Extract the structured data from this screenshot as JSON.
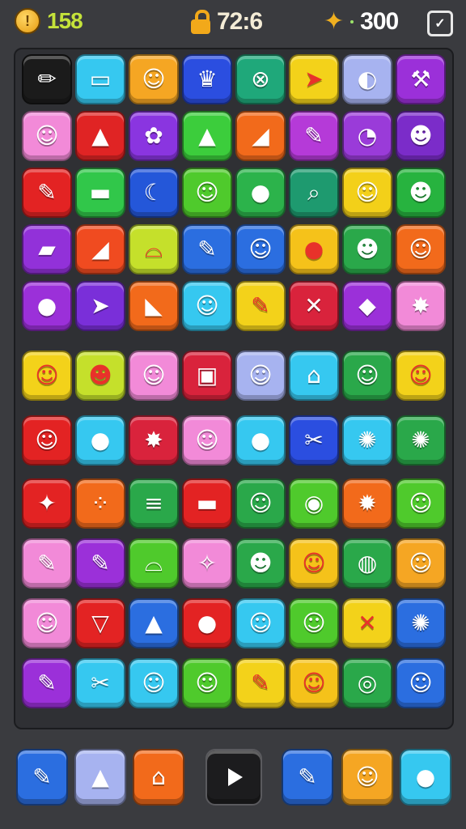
{
  "hud": {
    "coins": "158",
    "coin_icon": "coin-icon",
    "timer": "72:6",
    "lock_icon": "lock-icon",
    "score": "300",
    "star_icon": "star-icon",
    "menu_icon": "chevron-down-icon",
    "colors": {
      "coins": "#c4e23a",
      "timer": "#f4ecd6",
      "score": "#ffffff",
      "background": "#3a3b3f"
    }
  },
  "board": {
    "rows": [
      [
        {
          "c": "#1b1b1b",
          "g": "✏",
          "n": "pencil-icon"
        },
        {
          "c": "#36c8f0",
          "g": "▭",
          "n": "bar-icon"
        },
        {
          "c": "#f5a623",
          "g": "☺",
          "n": "face-icon"
        },
        {
          "c": "#2b4ee0",
          "g": "♛",
          "n": "crown-icon"
        },
        {
          "c": "#1fa87a",
          "g": "⊗",
          "n": "crossed-circle-icon"
        },
        {
          "c": "#f3d21a",
          "g": "➤",
          "n": "arrow-icon"
        },
        {
          "c": "#a7b3f0",
          "g": "◐",
          "n": "swirl-icon"
        },
        {
          "c": "#9b30d9",
          "g": "⚒",
          "n": "pickaxe-icon"
        }
      ],
      [
        {
          "c": "#f28ad8",
          "g": "☺",
          "n": "face-icon"
        },
        {
          "c": "#e02424",
          "g": "▲",
          "n": "cone-icon"
        },
        {
          "c": "#8a35e0",
          "g": "✿",
          "n": "flower-icon"
        },
        {
          "c": "#3ccd3c",
          "g": "▲",
          "n": "rainbow-cone-icon"
        },
        {
          "c": "#f26a1b",
          "g": "◢",
          "n": "wedge-icon"
        },
        {
          "c": "#b53ad8",
          "g": "✎",
          "n": "bottle-icon"
        },
        {
          "c": "#9a3bd9",
          "g": "◔",
          "n": "pacman-icon"
        },
        {
          "c": "#7b2cc9",
          "g": "☻",
          "n": "turtle-icon"
        }
      ],
      [
        {
          "c": "#e32323",
          "g": "✎",
          "n": "crayon-icon"
        },
        {
          "c": "#31c74a",
          "g": "▬",
          "n": "box-icon"
        },
        {
          "c": "#2457d9",
          "g": "☾",
          "n": "moon-icon"
        },
        {
          "c": "#4fca2c",
          "g": "☺",
          "n": "cat-icon"
        },
        {
          "c": "#2cb34b",
          "g": "●",
          "n": "ball-icon"
        },
        {
          "c": "#1e9a6f",
          "g": "⌕",
          "n": "magnifier-icon"
        },
        {
          "c": "#f3d019",
          "g": "☺",
          "n": "block-face-icon"
        },
        {
          "c": "#27b33f",
          "g": "☻",
          "n": "square-face-icon"
        }
      ],
      [
        {
          "c": "#9231d9",
          "g": "▰",
          "n": "eraser-icon"
        },
        {
          "c": "#f04b20",
          "g": "◢",
          "n": "wedge-icon"
        },
        {
          "c": "#c5e02b",
          "g": "⌓",
          "n": "bowl-icon"
        },
        {
          "c": "#2b6ee0",
          "g": "✎",
          "n": "pen-icon"
        },
        {
          "c": "#2b6ee0",
          "g": "☺",
          "n": "ghost-icon"
        },
        {
          "c": "#f5c21a",
          "g": "●",
          "n": "apple-icon"
        },
        {
          "c": "#2aa84a",
          "g": "☻",
          "n": "monster-icon"
        },
        {
          "c": "#f26a1b",
          "g": "☺",
          "n": "smiley-icon"
        }
      ],
      [
        {
          "c": "#9b30d9",
          "g": "●",
          "n": "bomb-icon"
        },
        {
          "c": "#7a2fd9",
          "g": "➤",
          "n": "rocket-icon"
        },
        {
          "c": "#f26a1b",
          "g": "◣",
          "n": "slice-icon"
        },
        {
          "c": "#36c8f0",
          "g": "☺",
          "n": "robot-icon"
        },
        {
          "c": "#f3d21a",
          "g": "✎",
          "n": "marker-icon"
        },
        {
          "c": "#d9233c",
          "g": "✕",
          "n": "tools-icon"
        },
        {
          "c": "#9b30d9",
          "g": "◆",
          "n": "drop-icon"
        },
        {
          "c": "#f28ad8",
          "g": "✸",
          "n": "splat-icon"
        }
      ],
      [
        {
          "c": "#f3d21a",
          "g": "☺",
          "n": "smiley-icon"
        },
        {
          "c": "#c5e02b",
          "g": "☻",
          "n": "frog-icon"
        },
        {
          "c": "#f28ad8",
          "g": "☺",
          "n": "face-icon"
        },
        {
          "c": "#d9233c",
          "g": "▣",
          "n": "cube-icon"
        },
        {
          "c": "#a7b3f0",
          "g": "☺",
          "n": "ghost-icon"
        },
        {
          "c": "#36c8f0",
          "g": "⌂",
          "n": "house-icon"
        },
        {
          "c": "#2aa84a",
          "g": "☺",
          "n": "wink-icon"
        },
        {
          "c": "#f3d21a",
          "g": "☺",
          "n": "owl-icon"
        }
      ],
      [
        {
          "c": "#e32323",
          "g": "☺",
          "n": "flame-icon"
        },
        {
          "c": "#36c8f0",
          "g": "●",
          "n": "ball-icon"
        },
        {
          "c": "#d9233c",
          "g": "✸",
          "n": "burst-icon"
        },
        {
          "c": "#f28ad8",
          "g": "☺",
          "n": "cat-icon"
        },
        {
          "c": "#36c8f0",
          "g": "●",
          "n": "lollipop-icon"
        },
        {
          "c": "#2b4ee0",
          "g": "✂",
          "n": "leaf-icon"
        },
        {
          "c": "#36c8f0",
          "g": "✺",
          "n": "sun-icon"
        },
        {
          "c": "#2aa84a",
          "g": "✺",
          "n": "flower-icon"
        }
      ],
      [
        {
          "c": "#e32323",
          "g": "✦",
          "n": "star-icon"
        },
        {
          "c": "#f26a1b",
          "g": "⁘",
          "n": "dots-icon"
        },
        {
          "c": "#2aa84a",
          "g": "≡",
          "n": "stack-icon"
        },
        {
          "c": "#e32323",
          "g": "▬",
          "n": "drum-icon"
        },
        {
          "c": "#2aa84a",
          "g": "☺",
          "n": "bag-icon"
        },
        {
          "c": "#4fca2c",
          "g": "◉",
          "n": "candy-icon"
        },
        {
          "c": "#f26a1b",
          "g": "✹",
          "n": "gear-icon"
        },
        {
          "c": "#4fca2c",
          "g": "☺",
          "n": "ghost-icon"
        }
      ],
      [
        {
          "c": "#f28ad8",
          "g": "✎",
          "n": "ruler-icon"
        },
        {
          "c": "#9b30d9",
          "g": "✎",
          "n": "notepad-icon"
        },
        {
          "c": "#4fca2c",
          "g": "⌓",
          "n": "pot-icon"
        },
        {
          "c": "#f28ad8",
          "g": "✧",
          "n": "bird-icon"
        },
        {
          "c": "#2aa84a",
          "g": "☻",
          "n": "crab-icon"
        },
        {
          "c": "#f5c21a",
          "g": "☺",
          "n": "parrot-icon"
        },
        {
          "c": "#2aa84a",
          "g": "◍",
          "n": "coin-icon"
        },
        {
          "c": "#f5a623",
          "g": "☺",
          "n": "skull-icon"
        }
      ],
      [
        {
          "c": "#f28ad8",
          "g": "☺",
          "n": "snail-icon"
        },
        {
          "c": "#e32323",
          "g": "▽",
          "n": "cup-icon"
        },
        {
          "c": "#2b6ee0",
          "g": "▲",
          "n": "rocket-icon"
        },
        {
          "c": "#e32323",
          "g": "●",
          "n": "bullet-icon"
        },
        {
          "c": "#36c8f0",
          "g": "☺",
          "n": "dice-icon"
        },
        {
          "c": "#4fca2c",
          "g": "☺",
          "n": "sleepy-face-icon"
        },
        {
          "c": "#f3d21a",
          "g": "✕",
          "n": "sticks-icon"
        },
        {
          "c": "#2b6ee0",
          "g": "✺",
          "n": "leaf-icon"
        }
      ],
      [
        {
          "c": "#9b30d9",
          "g": "✎",
          "n": "baton-icon"
        },
        {
          "c": "#36c8f0",
          "g": "✂",
          "n": "tag-icon"
        },
        {
          "c": "#36c8f0",
          "g": "☺",
          "n": "mask-icon"
        },
        {
          "c": "#4fca2c",
          "g": "☺",
          "n": "robot-icon"
        },
        {
          "c": "#f3d21a",
          "g": "✎",
          "n": "crayon-icon"
        },
        {
          "c": "#f5c21a",
          "g": "☺",
          "n": "blob-icon"
        },
        {
          "c": "#2aa84a",
          "g": "◎",
          "n": "target-icon"
        },
        {
          "c": "#2b6ee0",
          "g": "☺",
          "n": "cat-icon"
        }
      ]
    ]
  },
  "bottom": {
    "buttons": [
      {
        "c": "#2b6ee0",
        "g": "✎",
        "n": "crayon-icon"
      },
      {
        "c": "#a7b3f0",
        "g": "▲",
        "n": "tree-icon"
      },
      {
        "c": "#f26a1b",
        "g": "⌂",
        "n": "house-icon"
      },
      {
        "c": "#1c1c1e",
        "g": "",
        "n": "play-icon"
      },
      {
        "c": "#2b6ee0",
        "g": "✎",
        "n": "brush-icon"
      },
      {
        "c": "#f5a623",
        "g": "☺",
        "n": "blob-icon"
      },
      {
        "c": "#36c8f0",
        "g": "●",
        "n": "ball-icon"
      }
    ]
  }
}
